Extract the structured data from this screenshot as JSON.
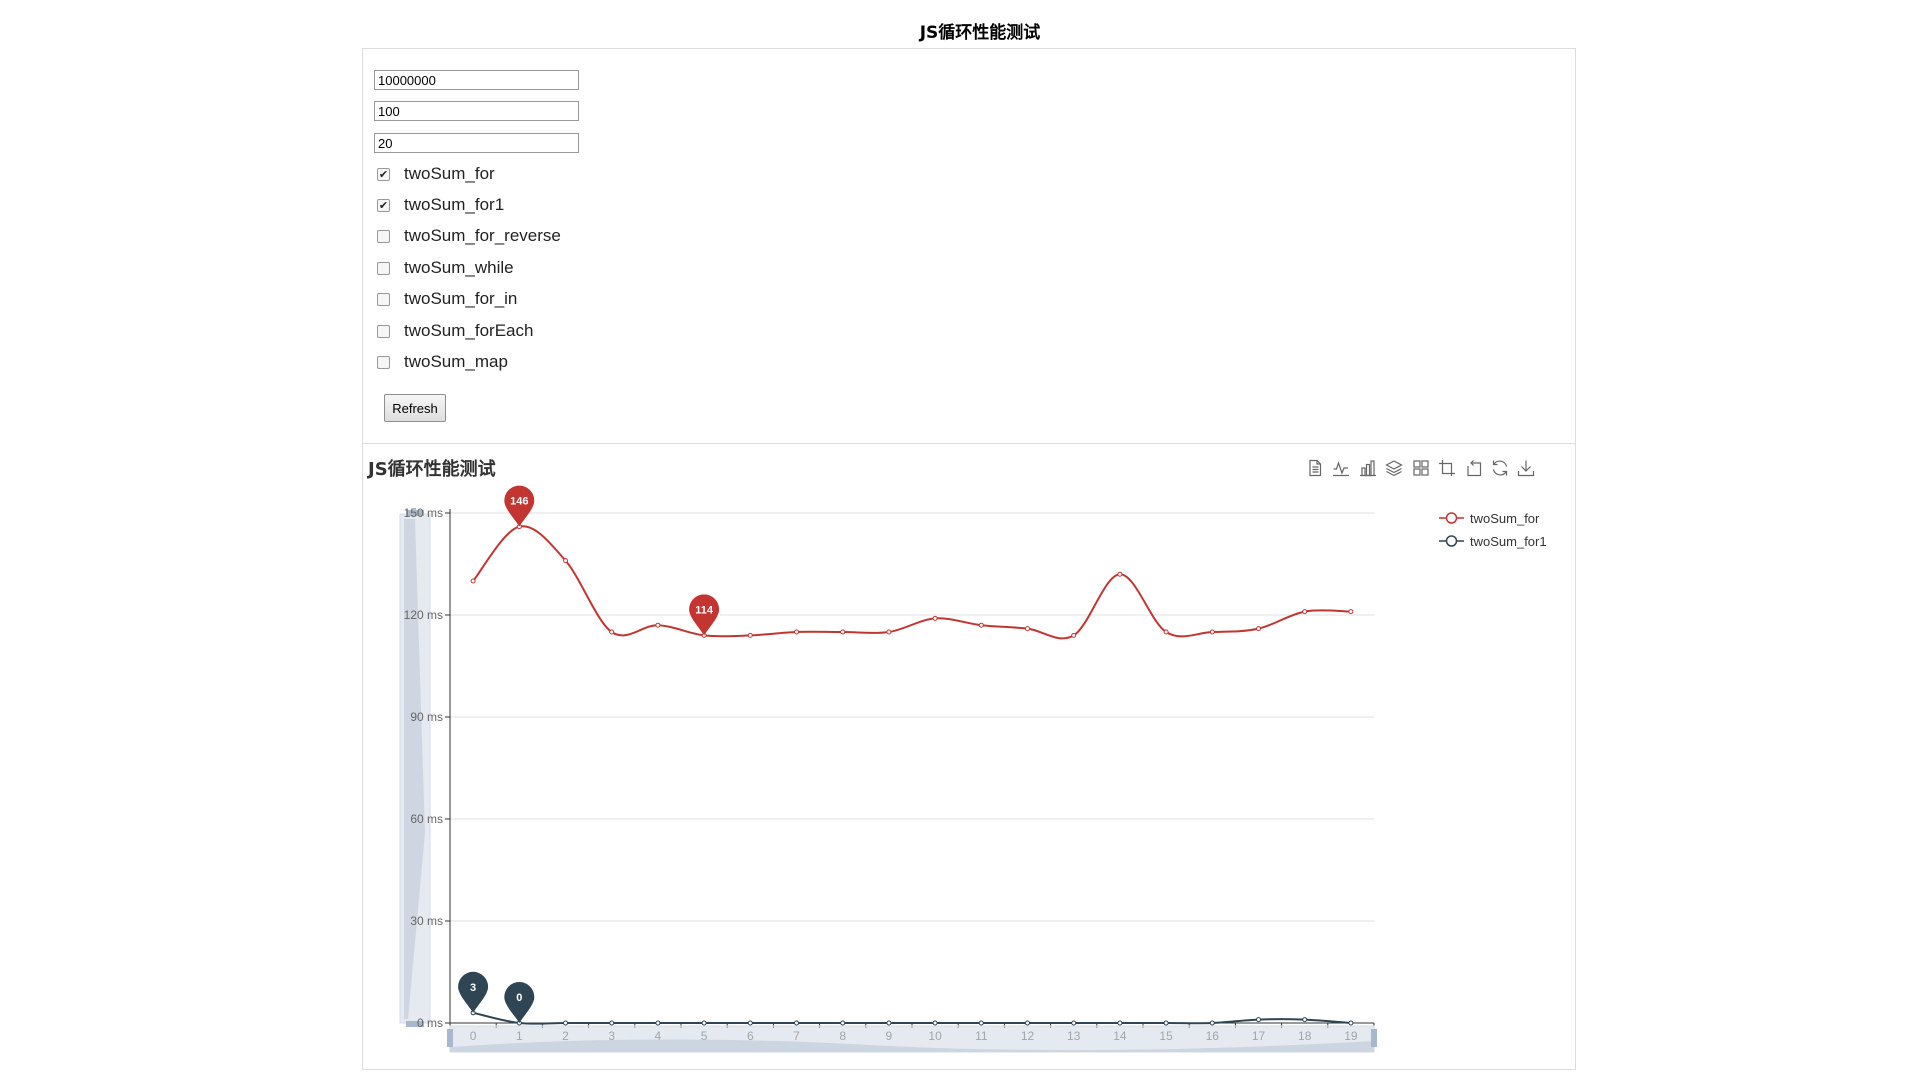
{
  "page": {
    "title": "JS循环性能测试"
  },
  "form": {
    "inputs": [
      {
        "name": "length-input",
        "value": "10000000"
      },
      {
        "name": "range-input",
        "value": "100"
      },
      {
        "name": "times-input",
        "value": "20"
      }
    ],
    "checkboxes": [
      {
        "label": "twoSum_for",
        "checked": true
      },
      {
        "label": "twoSum_for1",
        "checked": true
      },
      {
        "label": "twoSum_for_reverse",
        "checked": false
      },
      {
        "label": "twoSum_while",
        "checked": false
      },
      {
        "label": "twoSum_for_in",
        "checked": false
      },
      {
        "label": "twoSum_forEach",
        "checked": false
      },
      {
        "label": "twoSum_map",
        "checked": false
      }
    ],
    "refresh_label": "Refresh"
  },
  "toolbox": {
    "icons": [
      "data-view-icon",
      "line-chart-icon",
      "bar-chart-icon",
      "stack-icon",
      "tiled-icon",
      "zoom-icon",
      "zoom-reset-icon",
      "restore-icon",
      "download-icon"
    ]
  },
  "chart_data": {
    "type": "line",
    "title": "JS循环性能测试",
    "categories": [
      "0",
      "1",
      "2",
      "3",
      "4",
      "5",
      "6",
      "7",
      "8",
      "9",
      "10",
      "11",
      "12",
      "13",
      "14",
      "15",
      "16",
      "17",
      "18",
      "19"
    ],
    "y_unit": "ms",
    "ylim": [
      0,
      150
    ],
    "yticks": [
      0,
      30,
      60,
      90,
      120,
      150
    ],
    "grid": true,
    "smooth": true,
    "legend_position": "top-right",
    "series": [
      {
        "name": "twoSum_for",
        "color": "#c23531",
        "values": [
          130,
          146,
          136,
          115,
          117,
          114,
          114,
          115,
          115,
          115,
          119,
          117,
          116,
          114,
          132,
          115,
          115,
          116,
          121,
          121
        ],
        "markers": [
          {
            "type": "max",
            "index": 1,
            "value": 146
          },
          {
            "type": "min",
            "index": 5,
            "value": 114
          }
        ]
      },
      {
        "name": "twoSum_for1",
        "color": "#2f4554",
        "values": [
          3,
          0,
          0,
          0,
          0,
          0,
          0,
          0,
          0,
          0,
          0,
          0,
          0,
          0,
          0,
          0,
          0,
          1,
          1,
          0
        ],
        "markers": [
          {
            "type": "max",
            "index": 0,
            "value": 3
          },
          {
            "type": "min",
            "index": 1,
            "value": 0
          }
        ]
      }
    ]
  }
}
